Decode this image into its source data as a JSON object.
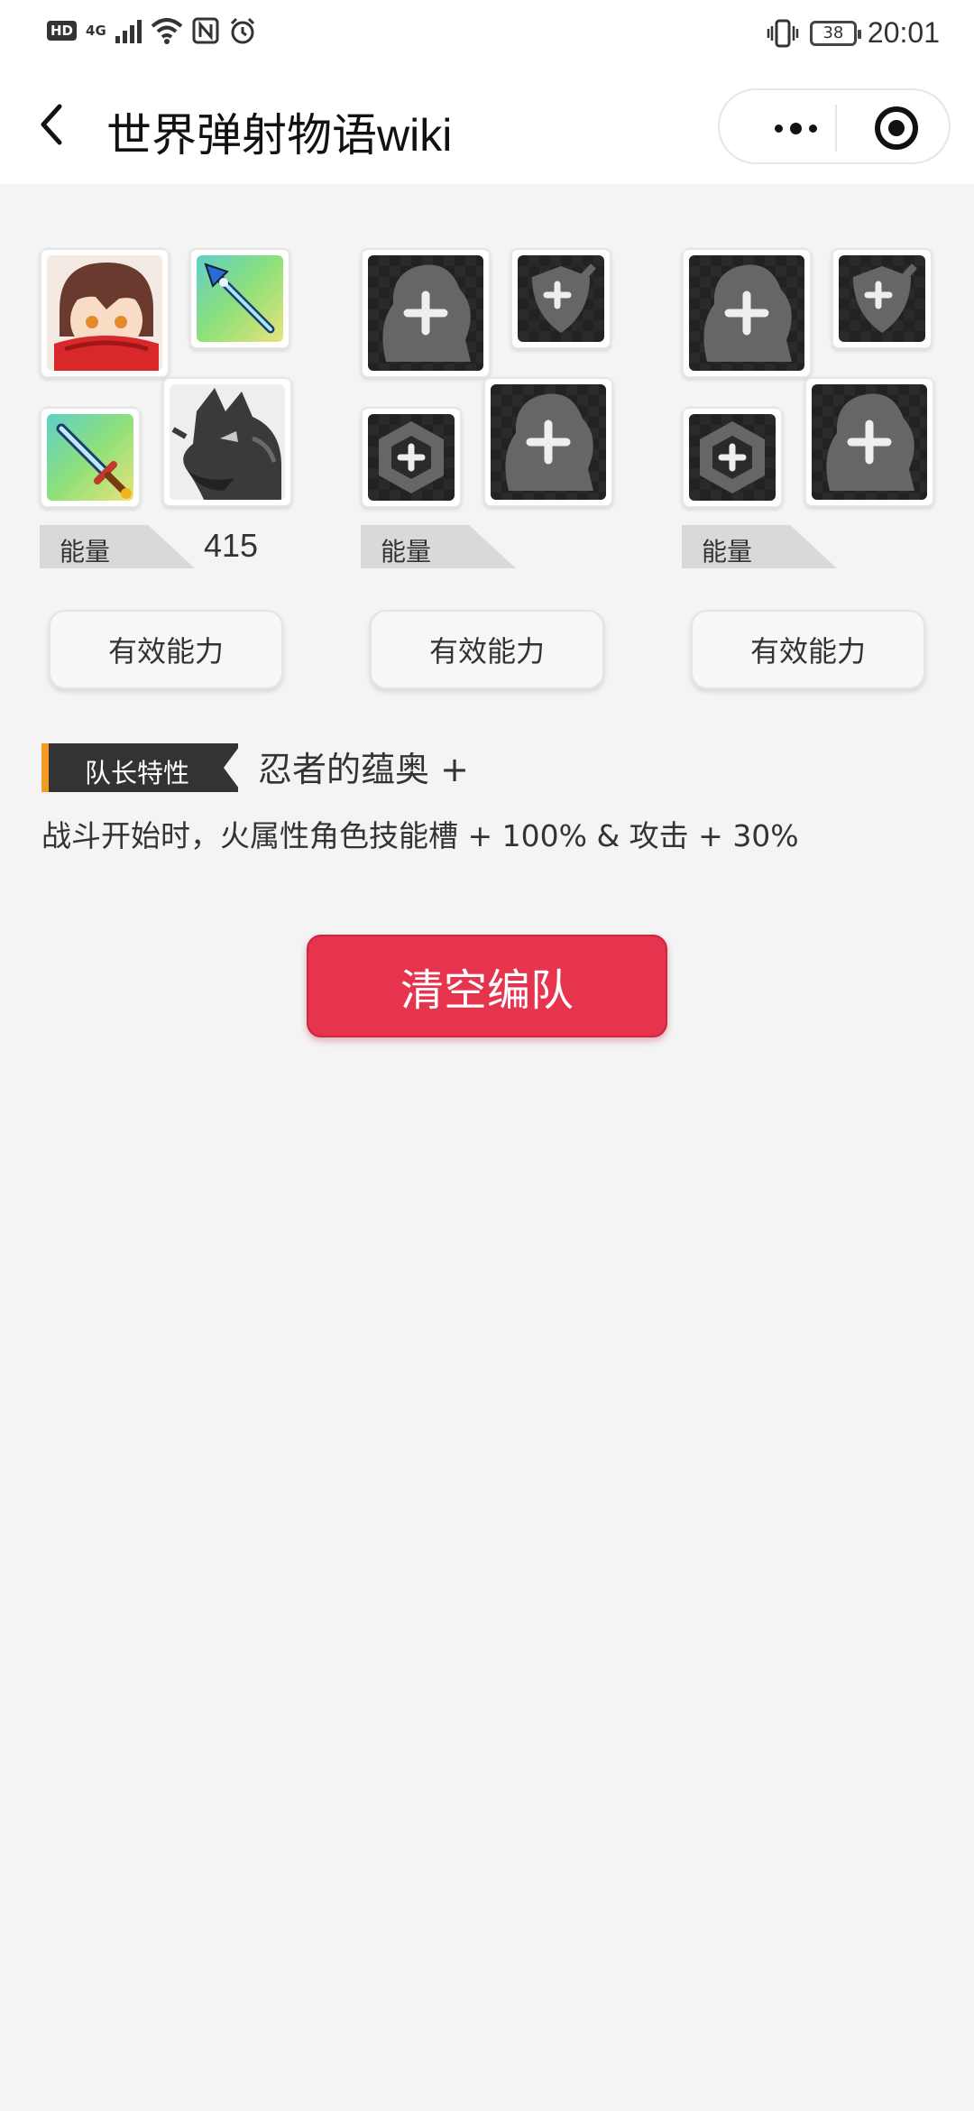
{
  "status_bar": {
    "left_badges": [
      "HD",
      "4G"
    ],
    "battery": "38",
    "time": "20:01"
  },
  "nav": {
    "title": "世界弹射物语wiki"
  },
  "teams": [
    {
      "energy_label": "能量",
      "energy_value": "415",
      "ability_label": "有效能力"
    },
    {
      "energy_label": "能量",
      "energy_value": "",
      "ability_label": "有效能力"
    },
    {
      "energy_label": "能量",
      "energy_value": "",
      "ability_label": "有效能力"
    }
  ],
  "leader": {
    "tag": "队长特性",
    "name": "忍者的蕴奥 +",
    "description": "战斗开始时，火属性角色技能槽 + 100% & 攻击 + 30%"
  },
  "actions": {
    "clear_label": "清空编队"
  },
  "colors": {
    "accent_red": "#e6344f",
    "leader_orange": "#f29a24",
    "tag_dark": "#333333"
  }
}
